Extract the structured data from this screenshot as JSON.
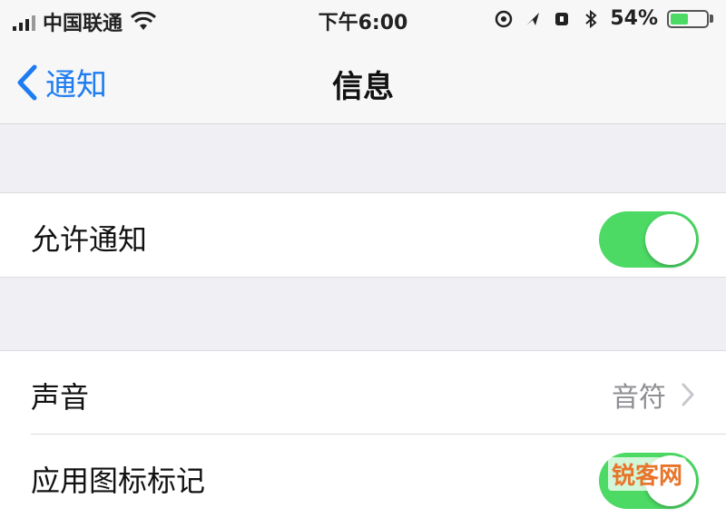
{
  "status_bar": {
    "carrier": "中国联通",
    "time": "下午6:00",
    "battery_percent": "54%",
    "battery_level": 0.54,
    "icons": [
      "signal-icon",
      "wifi-icon",
      "location-icon",
      "alarm-icon",
      "bluetooth-icon",
      "battery-icon"
    ]
  },
  "nav": {
    "back_label": "通知",
    "title": "信息"
  },
  "settings": {
    "allow_notifications": {
      "label": "允许通知",
      "enabled": true
    },
    "sounds": {
      "label": "声音",
      "value": "音符"
    },
    "badge_app_icon": {
      "label": "应用图标标记",
      "enabled": true
    }
  },
  "colors": {
    "accent": "#1e7cf2",
    "toggle_on": "#4cd964",
    "background": "#efeff4"
  },
  "watermark": "锐客网"
}
